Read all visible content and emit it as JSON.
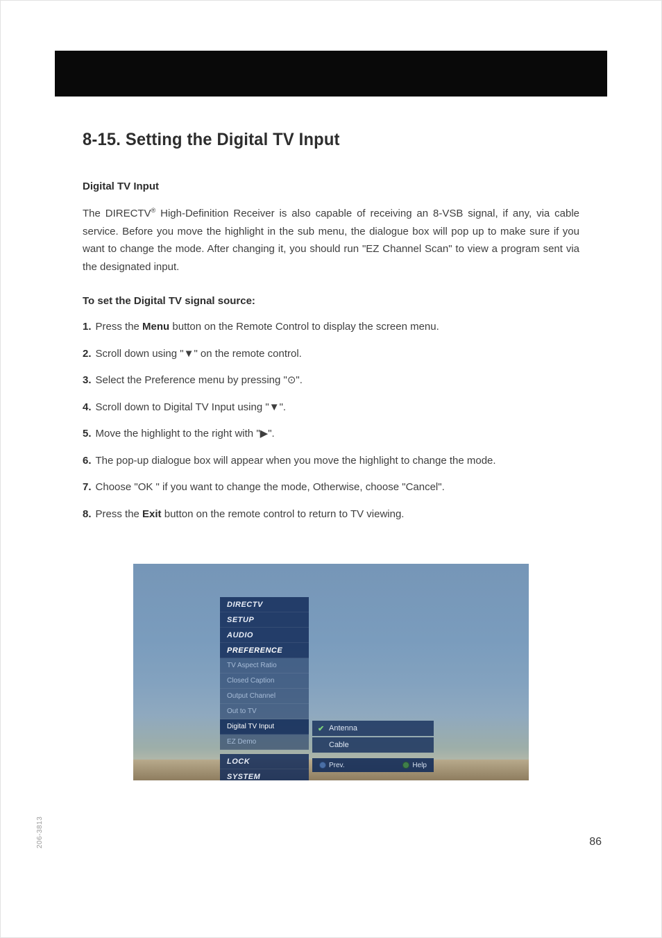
{
  "heading": "8-15. Setting the Digital TV Input",
  "section1_title": "Digital TV Input",
  "intro_pre": "The DIRECTV",
  "intro_reg": "®",
  "intro_post": " High-Definition Receiver is also capable of receiving an 8-VSB signal, if any, via cable service. Before you move the highlight in the sub menu, the dialogue box will pop up to make sure if you want to change the mode.  After changing it, you should run \"EZ Channel Scan\" to view a program sent via the designated input.",
  "section2_title": "To set the Digital TV signal source:",
  "steps": [
    {
      "pre": "Press the ",
      "bold": "Menu",
      "post": " button on the Remote Control to display the screen menu."
    },
    {
      "pre": "Scroll down using \"",
      "sym": "▼",
      "post": "\" on the remote control."
    },
    {
      "pre": "Select the Preference menu by pressing \"",
      "sym": "⊙",
      "post": "\"."
    },
    {
      "pre": "Scroll down to Digital TV Input using \"",
      "sym": "▼",
      "post": "\"."
    },
    {
      "pre": "Move the highlight to the right with \"",
      "sym": "▶",
      "post": "\"."
    },
    {
      "pre": "The pop-up dialogue box will appear when you move the highlight to change the mode."
    },
    {
      "pre": "Choose \"OK \" if you want to change the mode, Otherwise, choose \"Cancel\"."
    },
    {
      "pre": "Press the ",
      "bold": "Exit",
      "post": " button on the remote control to return to TV viewing."
    }
  ],
  "osd": {
    "top": [
      "DIRECTV",
      "SETUP",
      "AUDIO",
      "PREFERENCE"
    ],
    "pref_items": [
      "TV Aspect Ratio",
      "Closed Caption",
      "Output Channel",
      "Out to TV",
      "Digital TV Input",
      "EZ Demo"
    ],
    "bottom": [
      "LOCK",
      "SYSTEM"
    ],
    "options": [
      {
        "label": "Antenna",
        "checked": true
      },
      {
        "label": "Cable",
        "checked": false
      }
    ],
    "footer": {
      "left": "Prev.",
      "right": "Help"
    }
  },
  "side_code": "206-3813",
  "page_number": "86"
}
